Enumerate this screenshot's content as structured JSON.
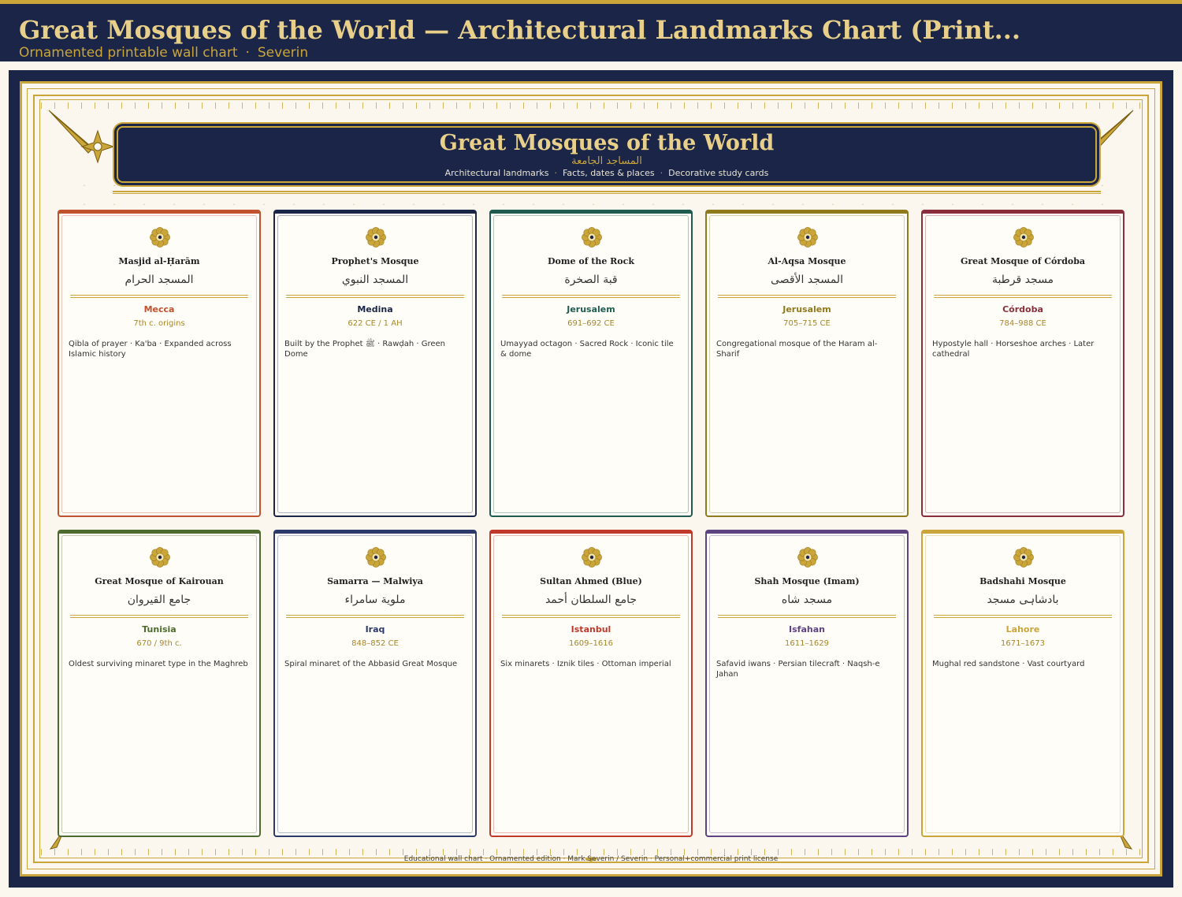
{
  "header": {
    "title": "Great Mosques of the World — Architectural Landmarks Chart (Print...",
    "subtitle_left": "Ornamented printable wall chart",
    "subtitle_sep": "·",
    "subtitle_right": "Severin"
  },
  "banner": {
    "title": "Great Mosques of the World",
    "arabic": "المساجد الجامعة",
    "tags": [
      "Architectural landmarks",
      "Facts, dates & places",
      "Decorative study cards"
    ],
    "tag_sep": "·"
  },
  "cards": [
    {
      "name": "Masjid al-Ḥarām",
      "arabic": "المسجد الحرام",
      "place": "Mecca",
      "date": "7th c. origins",
      "desc": "Qibla of prayer · Ka'ba · Expanded across Islamic history",
      "color": "#c0522d"
    },
    {
      "name": "Prophet's Mosque",
      "arabic": "المسجد النبوي",
      "place": "Medina",
      "date": "622 CE / 1 AH",
      "desc": "Built by the Prophet ﷺ · Rawḍah · Green Dome",
      "color": "#1b2547"
    },
    {
      "name": "Dome of the Rock",
      "arabic": "قبة الصخرة",
      "place": "Jerusalem",
      "date": "691–692 CE",
      "desc": "Umayyad octagon · Sacred Rock · Iconic tile & dome",
      "color": "#1f5c4f"
    },
    {
      "name": "Al-Aqsa Mosque",
      "arabic": "المسجد الأقصى",
      "place": "Jerusalem",
      "date": "705–715 CE",
      "desc": "Congregational mosque of the Haram al-Sharif",
      "color": "#8f7a1e"
    },
    {
      "name": "Great Mosque of Córdoba",
      "arabic": "مسجد قرطبة",
      "place": "Córdoba",
      "date": "784–988 CE",
      "desc": "Hypostyle hall · Horseshoe arches · Later cathedral",
      "color": "#8a2e3c"
    },
    {
      "name": "Great Mosque of Kairouan",
      "arabic": "جامع القيروان",
      "place": "Tunisia",
      "date": "670 / 9th c.",
      "desc": "Oldest surviving minaret type in the Maghreb",
      "color": "#4d6b2e"
    },
    {
      "name": "Samarra — Malwiya",
      "arabic": "ملوية سامراء",
      "place": "Iraq",
      "date": "848–852 CE",
      "desc": "Spiral minaret of the Abbasid Great Mosque",
      "color": "#2c3a6b"
    },
    {
      "name": "Sultan Ahmed (Blue)",
      "arabic": "جامع السلطان أحمد",
      "place": "Istanbul",
      "date": "1609–1616",
      "desc": "Six minarets · Iznik tiles · Ottoman imperial",
      "color": "#c0392b"
    },
    {
      "name": "Shah Mosque (Imam)",
      "arabic": "مسجد شاه",
      "place": "Isfahan",
      "date": "1611–1629",
      "desc": "Safavid iwans · Persian tilecraft · Naqsh-e Jahan",
      "color": "#5e4383"
    },
    {
      "name": "Badshahi Mosque",
      "arabic": "بادشاہی مسجد",
      "place": "Lahore",
      "date": "1671–1673",
      "desc": "Mughal red sandstone · Vast courtyard",
      "color": "#c9a53a"
    }
  ],
  "footer": "Educational wall chart · Ornamented edition · Mark Severin / Severin · Personal+commercial print license",
  "colors": {
    "navy": "#1b2547",
    "gold": "#c9a53a",
    "cream": "#fbf7ee"
  }
}
